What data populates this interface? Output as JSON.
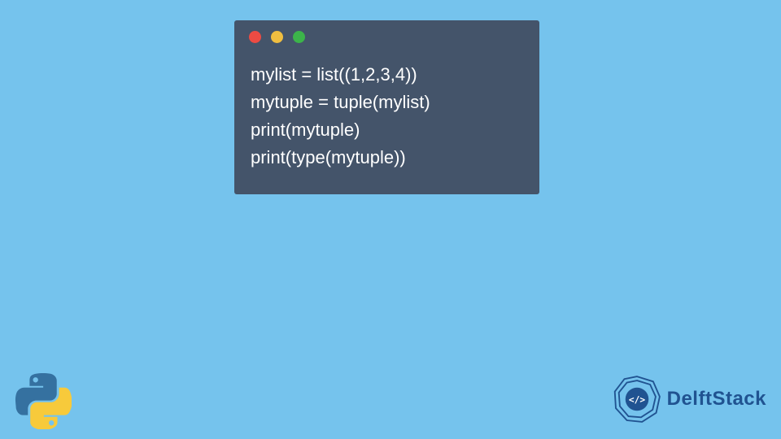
{
  "code": {
    "lines": [
      "mylist = list((1,2,3,4))",
      "mytuple = tuple(mylist)",
      "print(mytuple)",
      "print(type(mytuple))"
    ]
  },
  "branding": {
    "name": "DelftStack",
    "emblem_glyph": "</>"
  },
  "colors": {
    "page_bg": "#75c3ed",
    "window_bg": "#44546a",
    "dot_red": "#ed4b43",
    "dot_yellow": "#f0be40",
    "dot_green": "#3cb44a",
    "brand_blue": "#205391",
    "python_blue": "#3571a0",
    "python_yellow": "#f7ca3b"
  }
}
